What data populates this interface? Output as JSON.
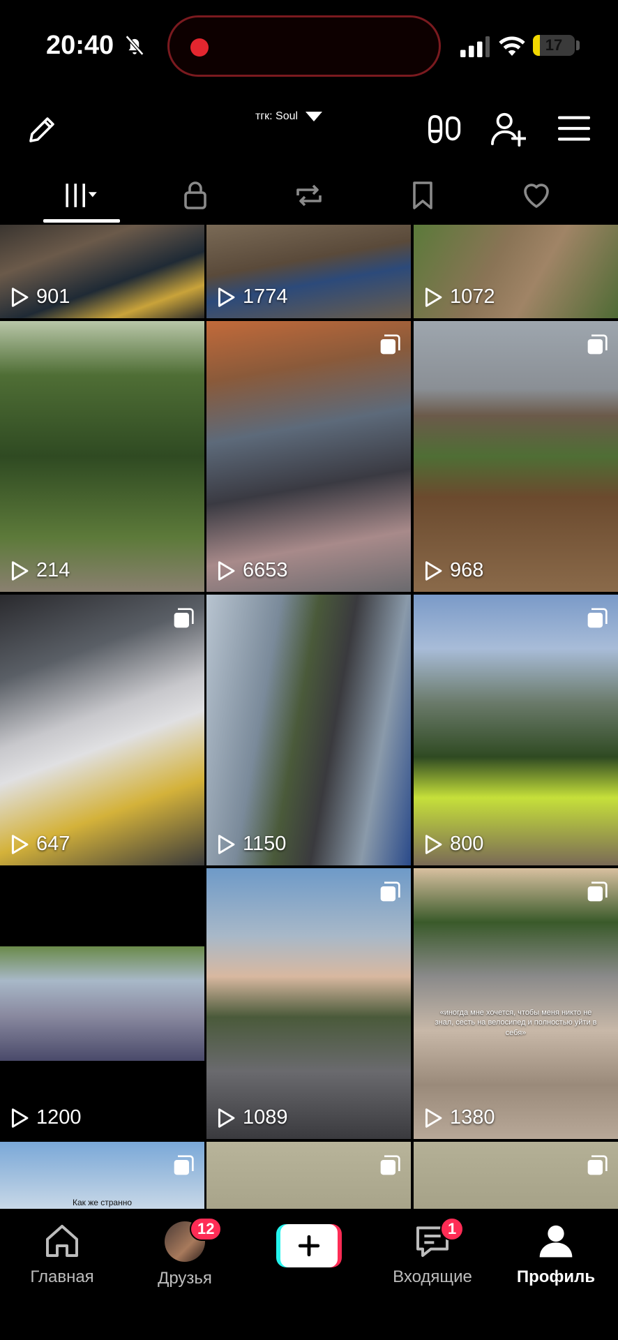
{
  "status_bar": {
    "time": "20:40",
    "battery_level": "17",
    "battery_fraction": 0.17
  },
  "header": {
    "account_name": "тгк: Soul"
  },
  "tabs": [
    {
      "name": "videos",
      "icon": "grid-icon",
      "active": true
    },
    {
      "name": "private",
      "icon": "lock-icon",
      "active": false
    },
    {
      "name": "reposts",
      "icon": "repost-icon",
      "active": false
    },
    {
      "name": "favorites",
      "icon": "bookmark-icon",
      "active": false
    },
    {
      "name": "liked",
      "icon": "heart-icon",
      "active": false
    }
  ],
  "videos": [
    {
      "views": "901",
      "multi": false
    },
    {
      "views": "1774",
      "multi": false
    },
    {
      "views": "1072",
      "multi": false
    },
    {
      "views": "214",
      "multi": false
    },
    {
      "views": "6653",
      "multi": true
    },
    {
      "views": "968",
      "multi": true
    },
    {
      "views": "647",
      "multi": true
    },
    {
      "views": "1150",
      "multi": false
    },
    {
      "views": "800",
      "multi": true
    },
    {
      "views": "1200",
      "multi": false
    },
    {
      "views": "1089",
      "multi": true
    },
    {
      "views": "1380",
      "multi": true,
      "caption": "«иногда мне хочется, чтобы меня никто не знал, сесть на велосипед и полностью уйти в себя»"
    },
    {
      "views": "",
      "multi": true,
      "caption": "Как же странно"
    },
    {
      "views": "",
      "multi": true
    },
    {
      "views": "",
      "multi": true
    }
  ],
  "bottom_nav": {
    "home_label": "Главная",
    "friends_label": "Друзья",
    "friends_badge": "12",
    "inbox_label": "Входящие",
    "inbox_badge": "1",
    "profile_label": "Профиль"
  },
  "colors": {
    "accent_pink": "#fe2c55",
    "accent_cyan": "#25f4ee",
    "record_red": "#e3262f",
    "battery_yellow": "#f2d800"
  }
}
